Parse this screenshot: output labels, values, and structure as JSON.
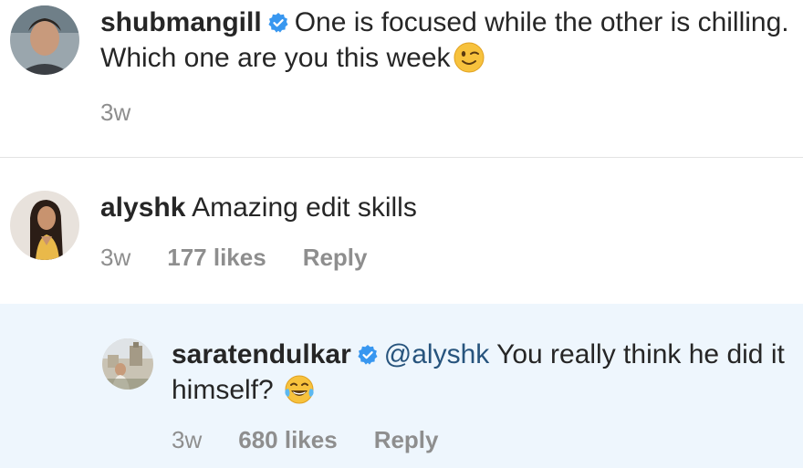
{
  "comments": [
    {
      "username": "shubmangill",
      "verified": true,
      "text": "One is focused while the other is chilling. Which one are you this week",
      "emoji": "winking-face",
      "time": "3w"
    },
    {
      "username": "alyshk",
      "verified": false,
      "text": "Amazing edit skills",
      "time": "3w",
      "likes": "177 likes",
      "reply": "Reply"
    },
    {
      "username": "saratendulkar",
      "verified": true,
      "mention": "@alyshk",
      "text": "You really think he did it himself?",
      "emoji": "face-with-tears-of-joy",
      "time": "3w",
      "likes": "680 likes",
      "reply": "Reply"
    }
  ],
  "colors": {
    "verified_badge": "#3897f0",
    "reply_highlight_bg": "#eef6fd",
    "secondary_text": "#8e8e8e",
    "mention": "#27547d"
  }
}
